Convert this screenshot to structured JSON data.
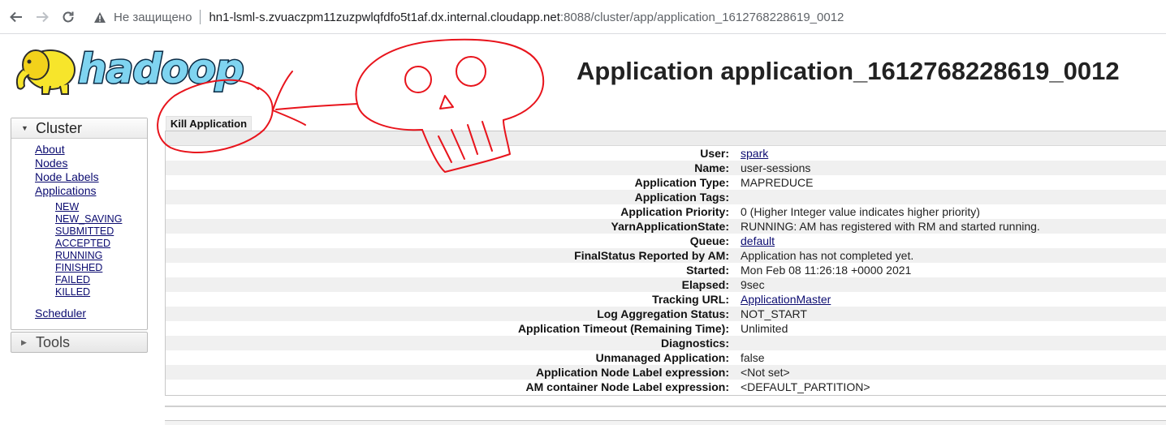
{
  "browser": {
    "insecure_label": "Не защищено",
    "url_host": "hn1-lsml-s.zvuaczpm11zuzpwlqfdfo5t1af.dx.internal.cloudapp.net",
    "url_path": ":8088/cluster/app/application_1612768228619_0012"
  },
  "logo": {
    "text": "hadoop"
  },
  "page_title": "Application application_1612768228619_0012",
  "sidebar": {
    "cluster_label": "Cluster",
    "links": [
      "About",
      "Nodes",
      "Node Labels",
      "Applications"
    ],
    "app_states": [
      "NEW",
      "NEW_SAVING",
      "SUBMITTED",
      "ACCEPTED",
      "RUNNING",
      "FINISHED",
      "FAILED",
      "KILLED"
    ],
    "scheduler_label": "Scheduler",
    "tools_label": "Tools"
  },
  "kill_button_label": "Kill Application",
  "info": [
    {
      "key": "User:",
      "value": "spark",
      "link": true
    },
    {
      "key": "Name:",
      "value": "user-sessions"
    },
    {
      "key": "Application Type:",
      "value": "MAPREDUCE"
    },
    {
      "key": "Application Tags:",
      "value": ""
    },
    {
      "key": "Application Priority:",
      "value": "0 (Higher Integer value indicates higher priority)"
    },
    {
      "key": "YarnApplicationState:",
      "value": "RUNNING: AM has registered with RM and started running."
    },
    {
      "key": "Queue:",
      "value": "default",
      "link": true
    },
    {
      "key": "FinalStatus Reported by AM:",
      "value": "Application has not completed yet."
    },
    {
      "key": "Started:",
      "value": "Mon Feb 08 11:26:18 +0000 2021"
    },
    {
      "key": "Elapsed:",
      "value": "9sec"
    },
    {
      "key": "Tracking URL:",
      "value": "ApplicationMaster",
      "link": true
    },
    {
      "key": "Log Aggregation Status:",
      "value": "NOT_START"
    },
    {
      "key": "Application Timeout (Remaining Time):",
      "value": "Unlimited"
    },
    {
      "key": "Diagnostics:",
      "value": ""
    },
    {
      "key": "Unmanaged Application:",
      "value": "false"
    },
    {
      "key": "Application Node Label expression:",
      "value": "<Not set>"
    },
    {
      "key": "AM container Node Label expression:",
      "value": "<DEFAULT_PARTITION>"
    }
  ],
  "colors": {
    "link": "#0b0b70",
    "annotation": "#e8141c",
    "logo_fill": "#7fd4f0",
    "elephant": "#f7e52b"
  }
}
